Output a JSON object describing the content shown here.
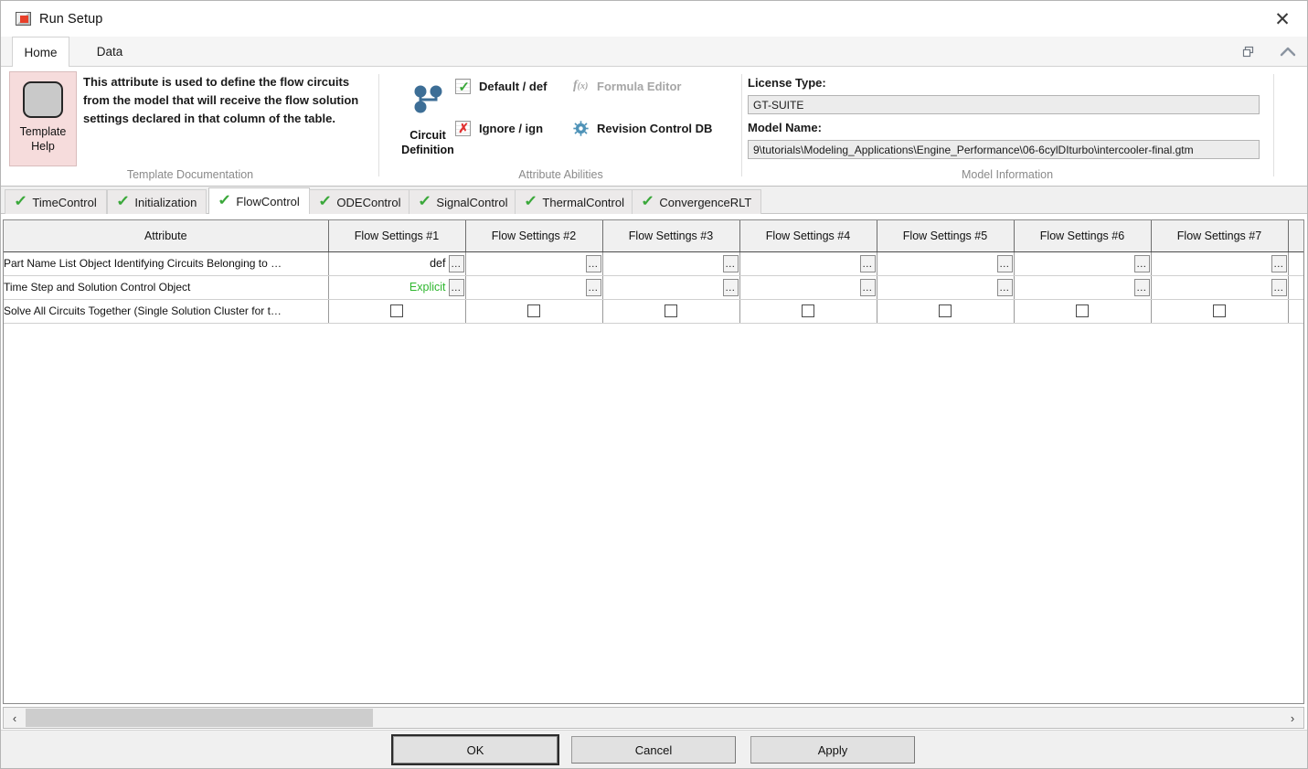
{
  "window": {
    "title": "Run Setup",
    "app_icon": "app-icon",
    "close_label": "✕"
  },
  "ribbon": {
    "tabs": [
      {
        "label": "Home",
        "active": true
      },
      {
        "label": "Data",
        "active": false
      }
    ],
    "corner_icons": [
      "restore-window-icon",
      "collapse-ribbon-icon"
    ],
    "groups": {
      "template_documentation": {
        "group_title": "Template Documentation",
        "help_button_label_line1": "Template",
        "help_button_label_line2": "Help",
        "description": "This attribute is used to define the flow circuits from the model that will receive the flow solution settings declared in that column of the table."
      },
      "attribute_abilities": {
        "group_title": "Attribute Abilities",
        "circuit_label_line1": "Circuit",
        "circuit_label_line2": "Definition",
        "items": [
          {
            "label": "Default / def",
            "icon": "checkbox-green-check-icon",
            "disabled": false,
            "mark": "✓",
            "mark_color": "#3aa83a"
          },
          {
            "label": "Ignore / ign",
            "icon": "checkbox-red-x-icon",
            "disabled": false,
            "mark": "✕",
            "mark_color": "#e03131"
          },
          {
            "label": "Formula Editor",
            "icon": "fx-icon",
            "disabled": true
          },
          {
            "label": "Revision Control DB",
            "icon": "gear-icon",
            "disabled": false
          }
        ]
      },
      "model_information": {
        "group_title": "Model Information",
        "license_type_label": "License Type:",
        "license_type_value": "GT-SUITE",
        "model_name_label": "Model Name:",
        "model_name_value": "9\\tutorials\\Modeling_Applications\\Engine_Performance\\06-6cylDIturbo\\intercooler-final.gtm"
      }
    }
  },
  "subtabs": [
    {
      "label": "TimeControl",
      "active": false,
      "status": "✓"
    },
    {
      "label": "Initialization",
      "active": false,
      "status": "✓"
    },
    {
      "label": "FlowControl",
      "active": true,
      "status": "✓"
    },
    {
      "label": "ODEControl",
      "active": false,
      "status": "✓"
    },
    {
      "label": "SignalControl",
      "active": false,
      "status": "✓"
    },
    {
      "label": "ThermalControl",
      "active": false,
      "status": "✓"
    },
    {
      "label": "ConvergenceRLT",
      "active": false,
      "status": "✓"
    }
  ],
  "table": {
    "columns": [
      "Attribute",
      "Flow Settings #1",
      "Flow Settings #2",
      "Flow Settings #3",
      "Flow Settings #4",
      "Flow Settings #5",
      "Flow Settings #6",
      "Flow Settings #7",
      ""
    ],
    "ellipsis_label": "...",
    "rows": [
      {
        "attribute": "Part Name List Object Identifying Circuits Belonging to …",
        "type": "object",
        "cells": [
          {
            "value": "def",
            "color": "dark",
            "selected": true
          },
          {
            "value": "",
            "color": "dark",
            "selected": false
          },
          {
            "value": "",
            "color": "dark",
            "selected": false
          },
          {
            "value": "",
            "color": "dark",
            "selected": false
          },
          {
            "value": "",
            "color": "dark",
            "selected": false
          },
          {
            "value": "",
            "color": "dark",
            "selected": false
          },
          {
            "value": "",
            "color": "dark",
            "selected": false
          }
        ]
      },
      {
        "attribute": "Time Step and Solution Control Object",
        "type": "object",
        "cells": [
          {
            "value": "Explicit",
            "color": "green",
            "selected": false
          },
          {
            "value": "",
            "color": "dark",
            "selected": false
          },
          {
            "value": "",
            "color": "dark",
            "selected": false
          },
          {
            "value": "",
            "color": "dark",
            "selected": false
          },
          {
            "value": "",
            "color": "dark",
            "selected": false
          },
          {
            "value": "",
            "color": "dark",
            "selected": false
          },
          {
            "value": "",
            "color": "dark",
            "selected": false
          }
        ]
      },
      {
        "attribute": "Solve All Circuits Together (Single Solution Cluster for t…",
        "type": "checkbox",
        "cells": [
          {
            "checked": false
          },
          {
            "checked": false
          },
          {
            "checked": false
          },
          {
            "checked": false
          },
          {
            "checked": false
          },
          {
            "checked": false
          },
          {
            "checked": false
          }
        ]
      }
    ]
  },
  "scrollbar": {
    "left_arrow": "‹",
    "right_arrow": "›"
  },
  "footer": {
    "ok_label": "OK",
    "cancel_label": "Cancel",
    "apply_label": "Apply"
  },
  "colors": {
    "accent_green": "#3aa83a",
    "selection": "#dcdcf5",
    "help_pink": "#f6dcdc",
    "circuit_blue": "#4a7fa5"
  }
}
